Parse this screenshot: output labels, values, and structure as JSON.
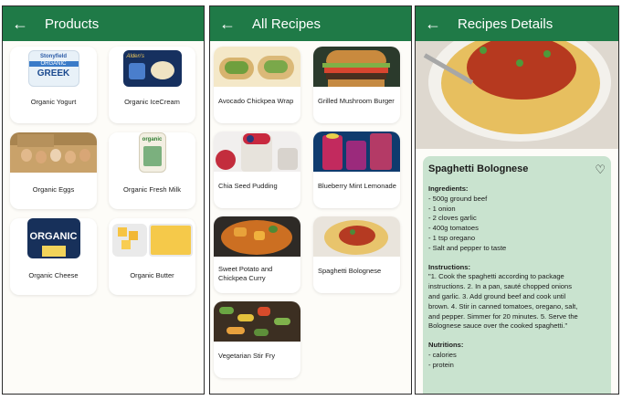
{
  "colors": {
    "accent": "#1f7a47",
    "card_bg": "#c9e3cf",
    "panel_bg": "#fdfcf8"
  },
  "products_screen": {
    "title": "Products",
    "back_icon": "arrow-left-icon",
    "items": [
      {
        "label": "Organic Yogurt"
      },
      {
        "label": "Organic IceCream"
      },
      {
        "label": "Organic Eggs"
      },
      {
        "label": "Organic Fresh Milk"
      },
      {
        "label": "Organic Cheese"
      },
      {
        "label": "Organic Butter"
      }
    ],
    "image_text": {
      "yogurt_brand": "Stonyfield",
      "yogurt_line1": "ORGANIC",
      "yogurt_line2": "GREEK",
      "icecream_brand": "Alden's",
      "milk_brand": "organic",
      "cheese_text": "ORGANIC"
    }
  },
  "recipes_screen": {
    "title": "All Recipes",
    "back_icon": "arrow-left-icon",
    "items": [
      {
        "label": "Avocado Chickpea Wrap"
      },
      {
        "label": "Grilled Mushroom Burger"
      },
      {
        "label": "Chia Seed Pudding"
      },
      {
        "label": "Blueberry Mint Lemonade"
      },
      {
        "label_line1": "Sweet Potato and",
        "label_line2": "Chickpea Curry"
      },
      {
        "label": "Spaghetti Bolognese"
      },
      {
        "label": "Vegetarian Stir Fry"
      }
    ]
  },
  "details_screen": {
    "title": "Recipes Details",
    "back_icon": "arrow-left-icon",
    "recipe_name": "Spaghetti Bolognese",
    "favorite_icon": "heart-outline-icon",
    "ingredients_heading": "Ingredients:",
    "ingredients": [
      "- 500g ground beef",
      "- 1 onion",
      "- 2 cloves garlic",
      "- 400g  tomatoes",
      "- 1 tsp oregano",
      "- Salt and pepper to taste"
    ],
    "instructions_heading": "Instructions:",
    "instructions_lines": [
      "\"1. Cook the spaghetti according to package",
      "instructions. 2. In a pan, sauté chopped onions",
      "and garlic. 3. Add ground beef and cook until",
      "brown. 4. Stir in canned tomatoes, oregano, salt,",
      "and pepper. Simmer for 20 minutes. 5. Serve the",
      "Bolognese sauce over the cooked spaghetti.\""
    ],
    "nutritions_heading": "Nutritions:",
    "nutritions": [
      "- calories",
      "- protein"
    ]
  }
}
